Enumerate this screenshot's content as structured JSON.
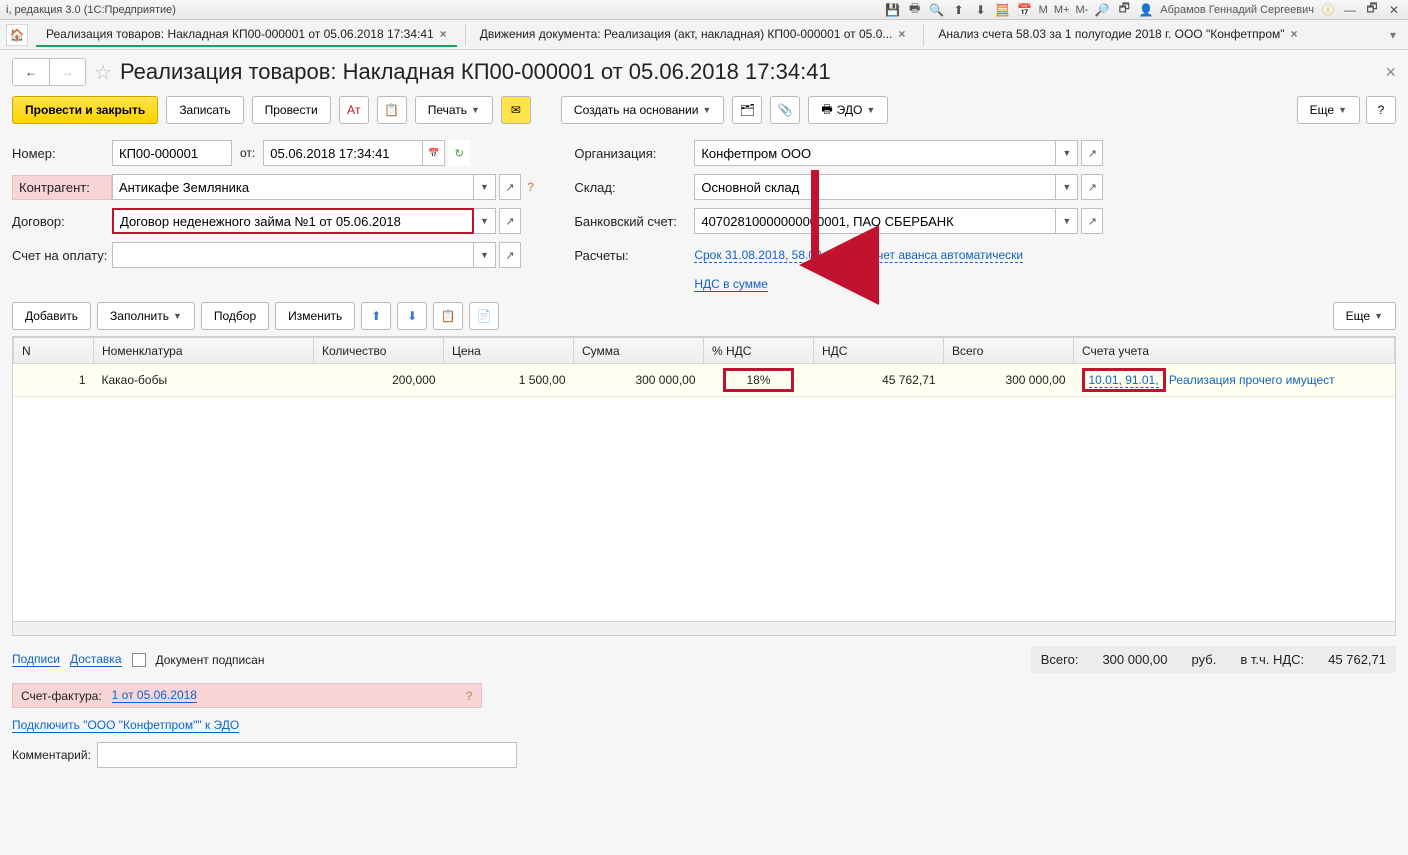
{
  "menubar": {
    "title_left": "і, редакция 3.0  (1С:Предприятие)",
    "user": "Абрамов Геннадий Сергеевич",
    "markers": [
      "М",
      "М+",
      "М-"
    ]
  },
  "tabs": [
    {
      "label": "Реализация товаров: Накладная КП00-000001 от 05.06.2018 17:34:41",
      "active": true
    },
    {
      "label": "Движения документа: Реализация (акт, накладная) КП00-000001 от 05.0...",
      "active": false
    },
    {
      "label": "Анализ счета 58.03 за 1 полугодие 2018 г. ООО \"Конфетпром\"",
      "active": false
    }
  ],
  "page_title": "Реализация товаров: Накладная КП00-000001 от 05.06.2018 17:34:41",
  "toolbar": {
    "post_close": "Провести и закрыть",
    "record": "Записать",
    "post": "Провести",
    "print": "Печать",
    "create_based_on": "Создать на основании",
    "edo": "ЭДО",
    "more": "Еще",
    "help": "?"
  },
  "form": {
    "number_label": "Номер:",
    "number_value": "КП00-000001",
    "from_label": "от:",
    "date_value": "05.06.2018 17:34:41",
    "counterparty_label": "Контрагент:",
    "counterparty_value": "Антикафе Земляника",
    "contract_label": "Договор:",
    "contract_value": "Договор неденежного займа №1 от 05.06.2018",
    "invoice_label": "Счет на оплату:",
    "invoice_value": "",
    "org_label": "Организация:",
    "org_value": "Конфетпром ООО",
    "warehouse_label": "Склад:",
    "warehouse_value": "Основной склад",
    "bank_label": "Банковский счет:",
    "bank_value": "40702810000000000001, ПАО СБЕРБАНК",
    "calc_label": "Расчеты:",
    "calc_link": "Срок 31.08.2018, 58.03, 58.03, зачет аванса автоматически",
    "vat_link": "НДС в сумме"
  },
  "tbl_toolbar": {
    "add": "Добавить",
    "fill": "Заполнить",
    "select": "Подбор",
    "change": "Изменить",
    "more": "Еще"
  },
  "columns": {
    "n": "N",
    "nomen": "Номенклатура",
    "qty": "Количество",
    "price": "Цена",
    "sum": "Сумма",
    "vatpct": "% НДС",
    "vat": "НДС",
    "total": "Всего",
    "accounts": "Счета учета"
  },
  "rows": [
    {
      "n": "1",
      "nomen": "Какао-бобы",
      "qty": "200,000",
      "price": "1 500,00",
      "sum": "300 000,00",
      "vatpct": "18%",
      "vat": "45 762,71",
      "total": "300 000,00",
      "acc": "10.01, 91.01,",
      "acc_tail": "Реализация прочего имущест"
    }
  ],
  "footer": {
    "sign": "Подписи",
    "delivery": "Доставка",
    "doc_signed": "Документ подписан",
    "total_label": "Всего:",
    "total_val": "300 000,00",
    "cur": "руб.",
    "vat_label": "в т.ч. НДС:",
    "vat_val": "45 762,71",
    "sf_label": "Счет-фактура:",
    "sf_link": "1 от 05.06.2018",
    "sf_q": "?",
    "edo_link": "Подключить \"ООО \"Конфетпром\"\" к ЭДО",
    "comment_label": "Комментарий:"
  }
}
